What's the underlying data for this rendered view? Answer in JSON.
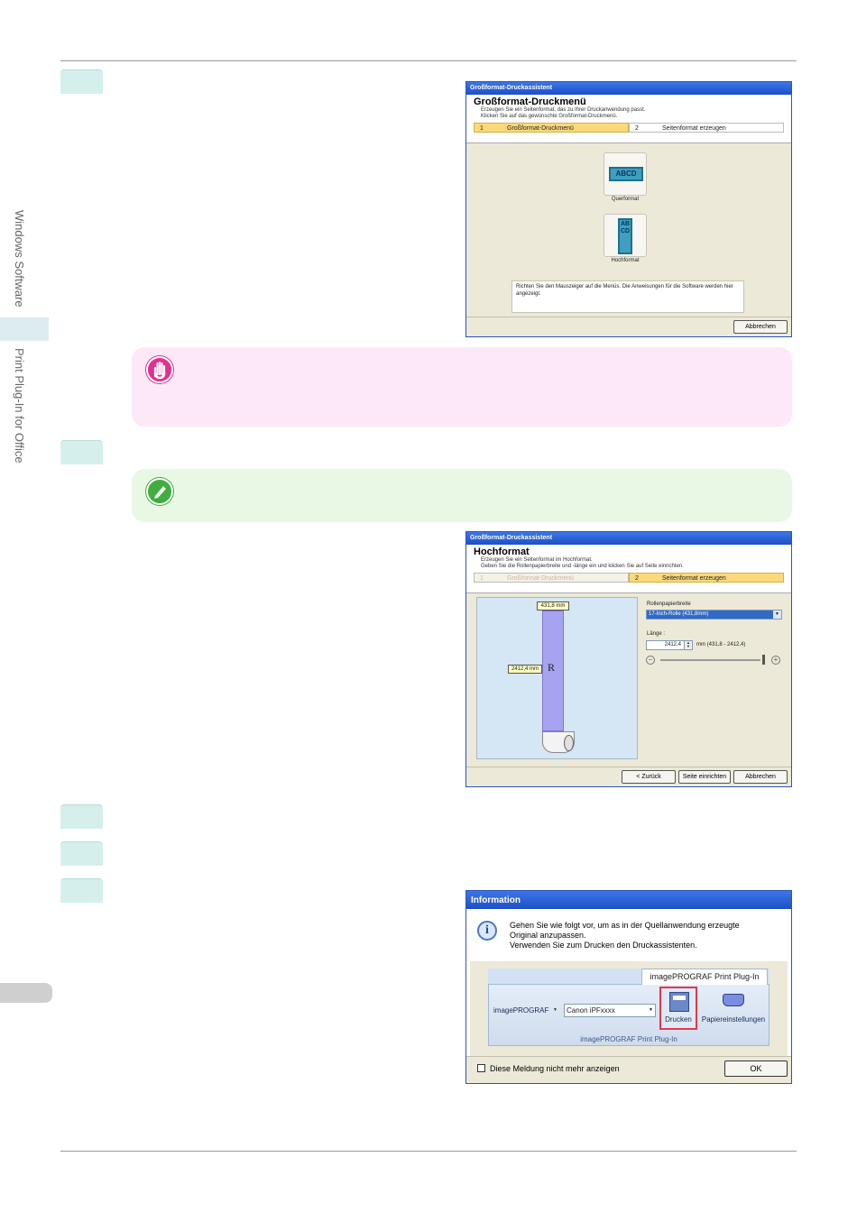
{
  "sidebar": {
    "section1": "Windows Software",
    "section2": "Print Plug-In for Office"
  },
  "dialog1": {
    "title": "Großformat-Druckassistent",
    "heading": "Großformat-Druckmenü",
    "desc1": "Erzeugen Sie ein Seitenformat, das zu Ihrer Druckanwendung passt.",
    "desc2": "Klicken Sie auf das gewünschte Großformat-Druckmenü.",
    "step1_num": "1",
    "step1_label": "Großformat-Druckmenü",
    "step2_num": "2",
    "step2_label": "Seitenformat erzeugen",
    "landscape_icon_text": "ABCD",
    "landscape_label": "Querformat",
    "portrait_icon_text": "ABCD",
    "portrait_label": "Hochformat",
    "hint": "Richten Sie den Mauszeiger auf die Menüs. Die Anweisungen für die Software werden hier angezeigt.",
    "cancel": "Abbrechen"
  },
  "dialog2": {
    "title": "Großformat-Druckassistent",
    "heading": "Hochformat",
    "desc1": "Erzeugen Sie ein Seitenformat im Hochformat.",
    "desc2": "Geben Sie die Rollenpapierbreite und -länge ein und klicken Sie auf Seite einrichten.",
    "step1_num": "1",
    "step1_label": "Großformat-Druckmenü",
    "step2_num": "2",
    "step2_label": "Seitenformat erzeugen",
    "width_tag": "431,8 mm",
    "length_tag": "2412,4 mm",
    "letter": "R",
    "roll_width_label": "Rollenpapierbreite",
    "roll_width_value": "17-Inch-Rolle (431,8mm)",
    "length_label": "Länge :",
    "length_value": "2412,4",
    "length_range": "mm (431,8 - 2412,4)",
    "back": "< Zurück",
    "setup": "Seite einrichten",
    "cancel": "Abbrechen"
  },
  "dialog3": {
    "title": "Information",
    "line1": "Gehen Sie wie folgt vor, um as in der Quellanwendung erzeugte",
    "line2": "Original anzupassen.",
    "line3": "Verwenden Sie zum Drucken den Druckassistenten.",
    "ribbon_tab": "imagePROGRAF Print Plug-In",
    "brand": "imagePROGRAF",
    "printer": "Canon iPFxxxx",
    "print_btn": "Drucken",
    "paper_btn": "Papiereinstellungen",
    "group_label": "imagePROGRAF Print Plug-In",
    "dont_show": "Diese Meldung nicht mehr anzeigen",
    "ok": "OK"
  }
}
